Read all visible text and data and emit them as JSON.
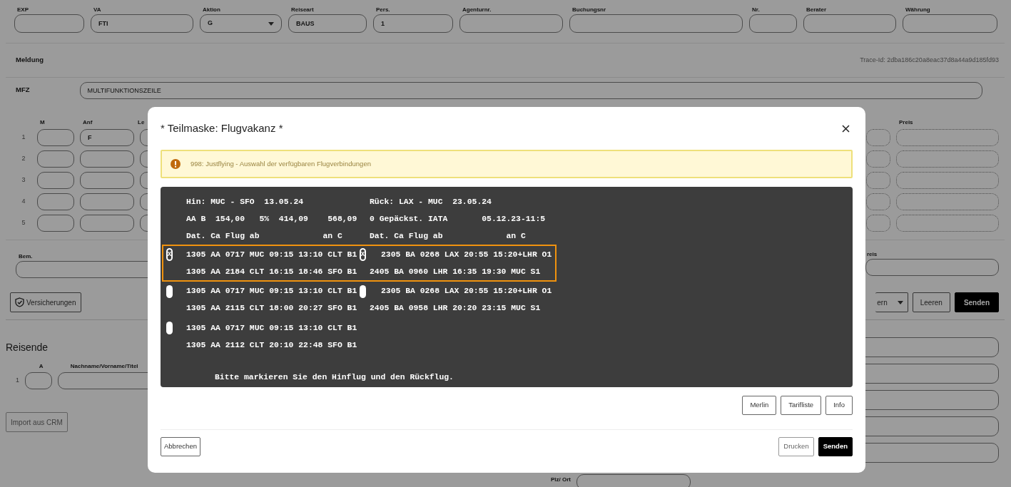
{
  "header_fields": [
    {
      "label": "EXP"
    },
    {
      "label": "VA",
      "value": "FTI"
    },
    {
      "label": "Aktion",
      "value": "G",
      "kind": "select"
    },
    {
      "label": "Reiseart",
      "value": "BAUS"
    },
    {
      "label": "Pers.",
      "value": "1"
    },
    {
      "label": "Agenturnr."
    },
    {
      "label": "Buchungsnr"
    },
    {
      "label": "Nr."
    },
    {
      "label": "Berater"
    },
    {
      "label": "Währung"
    }
  ],
  "meldung": {
    "label": "Meldung",
    "trace": "Trace-Id: 2dba186c20a8eac37d8a44a9d185fd93"
  },
  "mfz": {
    "label": "MFZ",
    "value": "MULTIFUNKTIONSZEILE"
  },
  "segments": {
    "columns": [
      "M",
      "Anf",
      "Le"
    ],
    "right_column": "Preis",
    "rows": [
      {
        "number": "1",
        "anf": "F"
      },
      {
        "number": "2"
      },
      {
        "number": "3"
      },
      {
        "number": "4"
      },
      {
        "number": "5"
      }
    ]
  },
  "remarks": {
    "label": "Bem.",
    "right_label": "reis"
  },
  "left_actions": [
    {
      "label": "Versicherungen"
    }
  ],
  "right_actions": [
    {
      "label": "ern",
      "kind": "dropdown"
    },
    {
      "label": "Leeren",
      "kind": "outline"
    },
    {
      "label": "Senden",
      "kind": "primary"
    }
  ],
  "travellers": {
    "title": "Reisende",
    "columns": [
      "A",
      "Nachname/Vorname/Titel"
    ],
    "rows": [
      {
        "number": "1"
      }
    ]
  },
  "import_button": "Import aus CRM",
  "address": {
    "label": "Plz/ Ort"
  },
  "modal": {
    "title": "* Teilmaske: Flugvakanz *",
    "alert": "998: Justflying - Auswahl der verfügbaren Flugverbindungen",
    "terminal": {
      "header": [
        {
          "left": "Hin: MUC - SFO  13.05.24",
          "right": "Rück: LAX - MUC  23.05.24"
        },
        {
          "left": "AA B  154,00   5%  414,09    568,09",
          "right": "0 Gepäckst. IATA       05.12.23-11:5"
        },
        {
          "left": "Dat. Ca Flug ab             an C",
          "right": "Dat. Ca Flug ab             an C"
        }
      ],
      "options": [
        {
          "selected": true,
          "outbound": {
            "checked": true,
            "mark": "X",
            "lines": [
              "1305 AA 0717 MUC 09:15 13:10 CLT B1",
              "1305 AA 2184 CLT 16:15 18:46 SFO B1"
            ]
          },
          "return": {
            "checked": true,
            "mark": "X",
            "lines": [
              "2305 BA 0268 LAX 20:55 15:20+LHR O1",
              "2405 BA 0960 LHR 16:35 19:30 MUC S1"
            ]
          }
        },
        {
          "selected": false,
          "outbound": {
            "checked": false,
            "lines": [
              "1305 AA 0717 MUC 09:15 13:10 CLT B1",
              "1305 AA 2115 CLT 18:00 20:27 SFO B1"
            ]
          },
          "return": {
            "checked": false,
            "lines": [
              "2305 BA 0268 LAX 20:55 15:20+LHR O1",
              "2405 BA 0958 LHR 20:20 23:15 MUC S1"
            ]
          }
        },
        {
          "selected": false,
          "outbound": {
            "checked": false,
            "lines": [
              "1305 AA 0717 MUC 09:15 13:10 CLT B1",
              "1305 AA 2112 CLT 20:10 22:48 SFO B1"
            ]
          }
        }
      ],
      "footer": "Bitte markieren Sie den Hinflug und den Rückflug."
    },
    "tool_buttons": [
      "Merlin",
      "Tarifliste",
      "Info"
    ],
    "cancel_button": "Abbrechen",
    "footer_buttons": [
      {
        "label": "Drucken",
        "kind": "outline"
      },
      {
        "label": "Senden",
        "kind": "primary"
      }
    ]
  }
}
